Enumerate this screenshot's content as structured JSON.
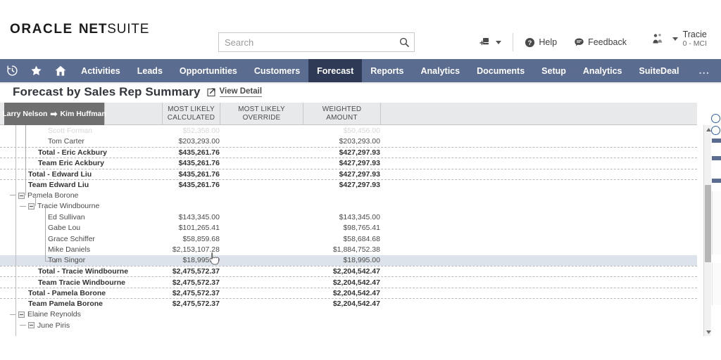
{
  "brand": {
    "oracle": "ORACLE",
    "netsuite_bold": "NET",
    "netsuite_light": "SUITE"
  },
  "search": {
    "placeholder": "Search",
    "value": ""
  },
  "header": {
    "help_label": "Help",
    "feedback_label": "Feedback",
    "user_name": "Tracie",
    "user_role": "0 - MCI"
  },
  "nav": {
    "items": [
      {
        "label": "Activities",
        "active": false
      },
      {
        "label": "Leads",
        "active": false
      },
      {
        "label": "Opportunities",
        "active": false
      },
      {
        "label": "Customers",
        "active": false
      },
      {
        "label": "Forecast",
        "active": true
      },
      {
        "label": "Reports",
        "active": false
      },
      {
        "label": "Analytics",
        "active": false
      },
      {
        "label": "Documents",
        "active": false
      },
      {
        "label": "Setup",
        "active": false
      },
      {
        "label": "Analytics",
        "active": false
      },
      {
        "label": "SuiteDeal",
        "active": false
      }
    ],
    "more_label": "..."
  },
  "page": {
    "title": "Forecast by Sales Rep Summary",
    "view_detail_label": "View Detail"
  },
  "breadcrumb": {
    "from": "Larry Nelson",
    "arrow": "➡",
    "to": "Kim Huffman"
  },
  "table": {
    "columns": [
      {
        "label": "MOST LIKELY CALCULATED"
      },
      {
        "label": "MOST LIKELY OVERRIDE"
      },
      {
        "label": "WEIGHTED AMOUNT"
      }
    ],
    "rows": [
      {
        "name": "Scott Forman",
        "most_likely_calculated": "$52,358.00",
        "weighted_amount": "$50,456.00",
        "style": "faded",
        "indent": 4
      },
      {
        "name": "Tom Carter",
        "most_likely_calculated": "$203,293.00",
        "weighted_amount": "$203,293.00",
        "style": "plain",
        "indent": 4
      },
      {
        "name": "Total - Eric Ackbury",
        "most_likely_calculated": "$435,261.76",
        "weighted_amount": "$427,297.93",
        "style": "bold",
        "indent": 3
      },
      {
        "name": "Team Eric Ackbury",
        "most_likely_calculated": "$435,261.76",
        "weighted_amount": "$427,297.93",
        "style": "bold",
        "indent": 3
      },
      {
        "name": "Total - Edward Liu",
        "most_likely_calculated": "$435,261.76",
        "weighted_amount": "$427,297.93",
        "style": "bold",
        "indent": 2
      },
      {
        "name": "Team Edward Liu",
        "most_likely_calculated": "$435,261.76",
        "weighted_amount": "$427,297.93",
        "style": "bold",
        "indent": 2
      },
      {
        "name": "Pamela Borone",
        "most_likely_calculated": "",
        "weighted_amount": "",
        "style": "node",
        "indent": 1
      },
      {
        "name": "Tracie Windbourne",
        "most_likely_calculated": "",
        "weighted_amount": "",
        "style": "node",
        "indent": 2
      },
      {
        "name": "Ed Sullivan",
        "most_likely_calculated": "$143,345.00",
        "weighted_amount": "$143,345.00",
        "style": "plain",
        "indent": 4
      },
      {
        "name": "Gabe Lou",
        "most_likely_calculated": "$101,265.41",
        "weighted_amount": "$98,765.41",
        "style": "plain",
        "indent": 4
      },
      {
        "name": "Grace Schiffer",
        "most_likely_calculated": "$58,859.68",
        "weighted_amount": "$58,684.68",
        "style": "plain",
        "indent": 4
      },
      {
        "name": "Mike Daniels",
        "most_likely_calculated": "$2,153,107.28",
        "weighted_amount": "$1,884,752.38",
        "style": "plain",
        "indent": 4
      },
      {
        "name": "Tom Singor",
        "most_likely_calculated": "$18,995.00",
        "weighted_amount": "$18,995.00",
        "style": "sel",
        "indent": 4
      },
      {
        "name": "Total - Tracie Windbourne",
        "most_likely_calculated": "$2,475,572.37",
        "weighted_amount": "$2,204,542.47",
        "style": "bold",
        "indent": 3
      },
      {
        "name": "Team Tracie Windbourne",
        "most_likely_calculated": "$2,475,572.37",
        "weighted_amount": "$2,204,542.47",
        "style": "bold",
        "indent": 3
      },
      {
        "name": "Total - Pamela Borone",
        "most_likely_calculated": "$2,475,572.37",
        "weighted_amount": "$2,204,542.47",
        "style": "bold",
        "indent": 2
      },
      {
        "name": "Team Pamela Borone",
        "most_likely_calculated": "$2,475,572.37",
        "weighted_amount": "$2,204,542.47",
        "style": "bold",
        "indent": 2
      },
      {
        "name": "Elaine Reynolds",
        "most_likely_calculated": "",
        "weighted_amount": "",
        "style": "node",
        "indent": 1
      },
      {
        "name": "June Piris",
        "most_likely_calculated": "",
        "weighted_amount": "",
        "style": "node",
        "indent": 2
      }
    ]
  },
  "colors": {
    "nav_bg": "#5b6c91",
    "nav_active_bg": "#2f3b56",
    "crumb_tab_bg": "#6f6f6f",
    "table_header_bg": "#e8e9eb",
    "selected_row_bg": "#dde3ea",
    "rail_accent": "#2f5fa8"
  }
}
